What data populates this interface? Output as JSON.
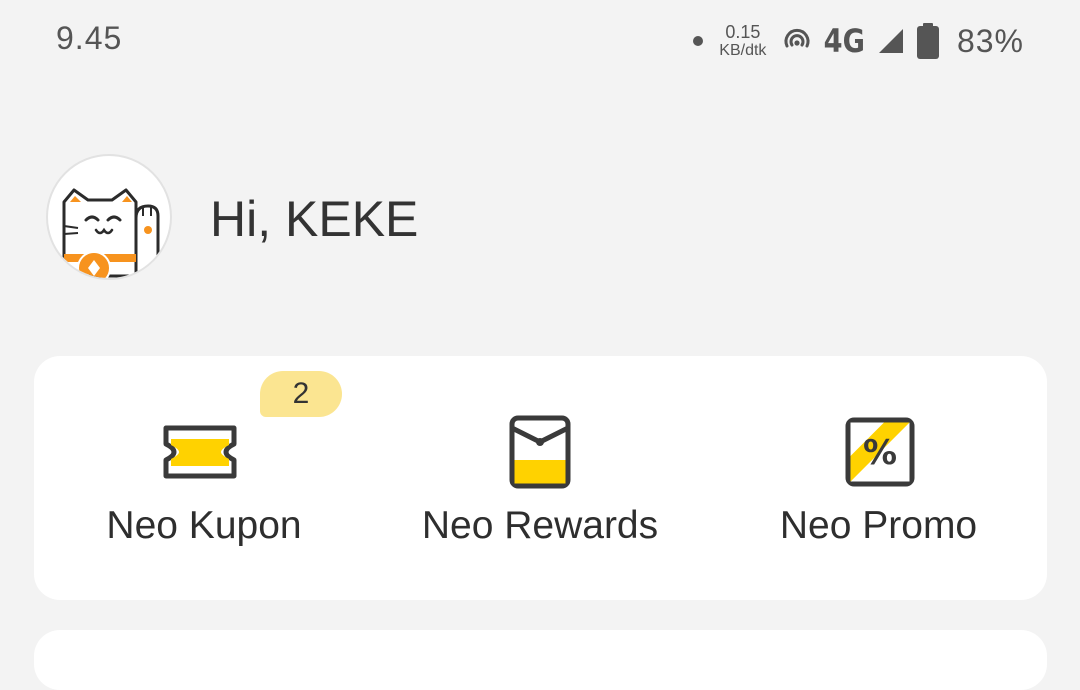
{
  "status_bar": {
    "time": "9.45",
    "speed_value": "0.15",
    "speed_unit": "KB/dtk",
    "network": "4G",
    "battery": "83%"
  },
  "profile": {
    "greeting": "Hi, KEKE"
  },
  "menu": {
    "items": [
      {
        "label": "Neo Kupon",
        "icon": "ticket-icon",
        "badge": "2"
      },
      {
        "label": "Neo Rewards",
        "icon": "envelope-icon"
      },
      {
        "label": "Neo Promo",
        "icon": "percent-icon"
      }
    ]
  },
  "colors": {
    "accent": "#ffd200",
    "badge_bg": "#fbe591",
    "background": "#f3f3f3",
    "icon_stroke": "#3a3a3a"
  }
}
